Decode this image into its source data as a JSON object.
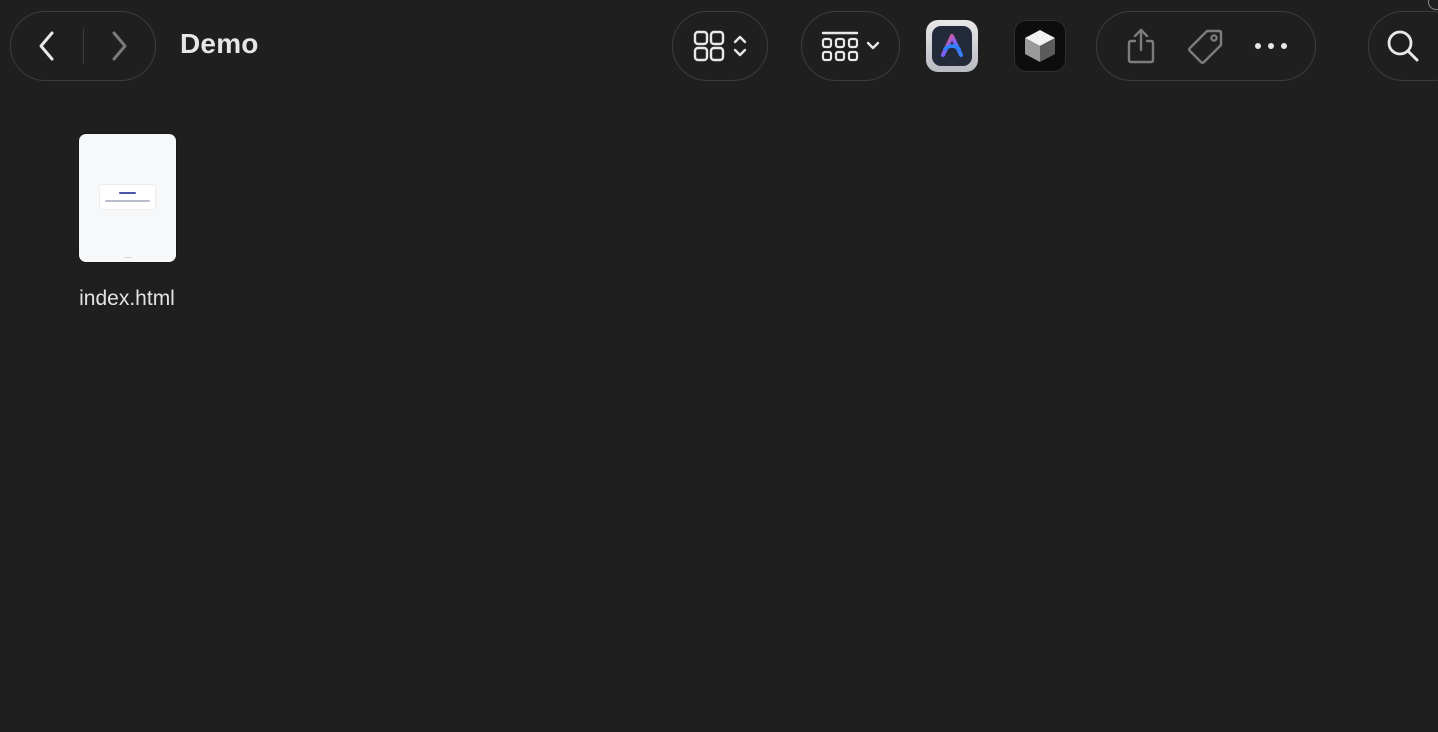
{
  "window": {
    "title": "Demo"
  },
  "toolbar": {
    "back_icon": "chevron-left-icon",
    "forward_icon": "chevron-right-icon",
    "view_icon": "grid-view-icon",
    "group_icon": "group-by-icon",
    "share_icon": "share-icon",
    "tag_icon": "tag-icon",
    "more_icon": "ellipsis-icon",
    "search_icon": "search-icon",
    "apps": [
      "arc-browser-icon",
      "cube-app-icon"
    ]
  },
  "files": [
    {
      "name": "index.html",
      "thumbnail": "html-document-thumbnail"
    }
  ],
  "colors": {
    "background": "#1f1f1f",
    "border": "#3c3c3c",
    "text": "#e6e6e6"
  }
}
